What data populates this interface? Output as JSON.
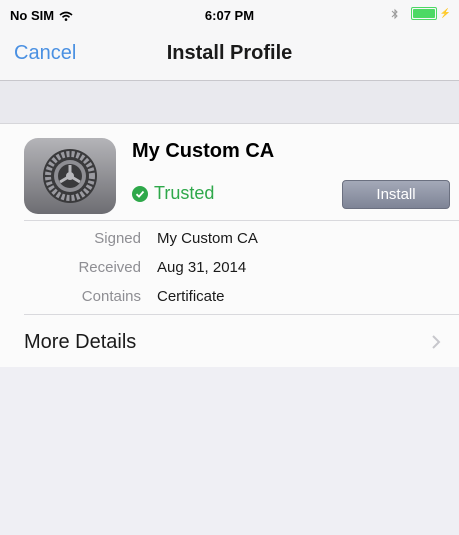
{
  "status_bar": {
    "carrier": "No SIM",
    "time": "6:07 PM",
    "colors": {
      "battery": "#4cd964"
    }
  },
  "nav": {
    "cancel_label": "Cancel",
    "title": "Install Profile",
    "colors": {
      "cancel": "#4a90e2"
    }
  },
  "profile": {
    "icon": "settings-gear-icon",
    "name": "My Custom CA",
    "status": "Trusted",
    "status_icon": "check-circle-icon",
    "install_label": "Install",
    "colors": {
      "trusted": "#2ea84a",
      "install_button": "#8e93a3"
    },
    "details": [
      {
        "label": "Signed",
        "value": "My Custom CA"
      },
      {
        "label": "Received",
        "value": "Aug 31, 2014"
      },
      {
        "label": "Contains",
        "value": "Certificate"
      }
    ]
  },
  "more_details": {
    "label": "More Details",
    "icon": "chevron-right-icon"
  }
}
